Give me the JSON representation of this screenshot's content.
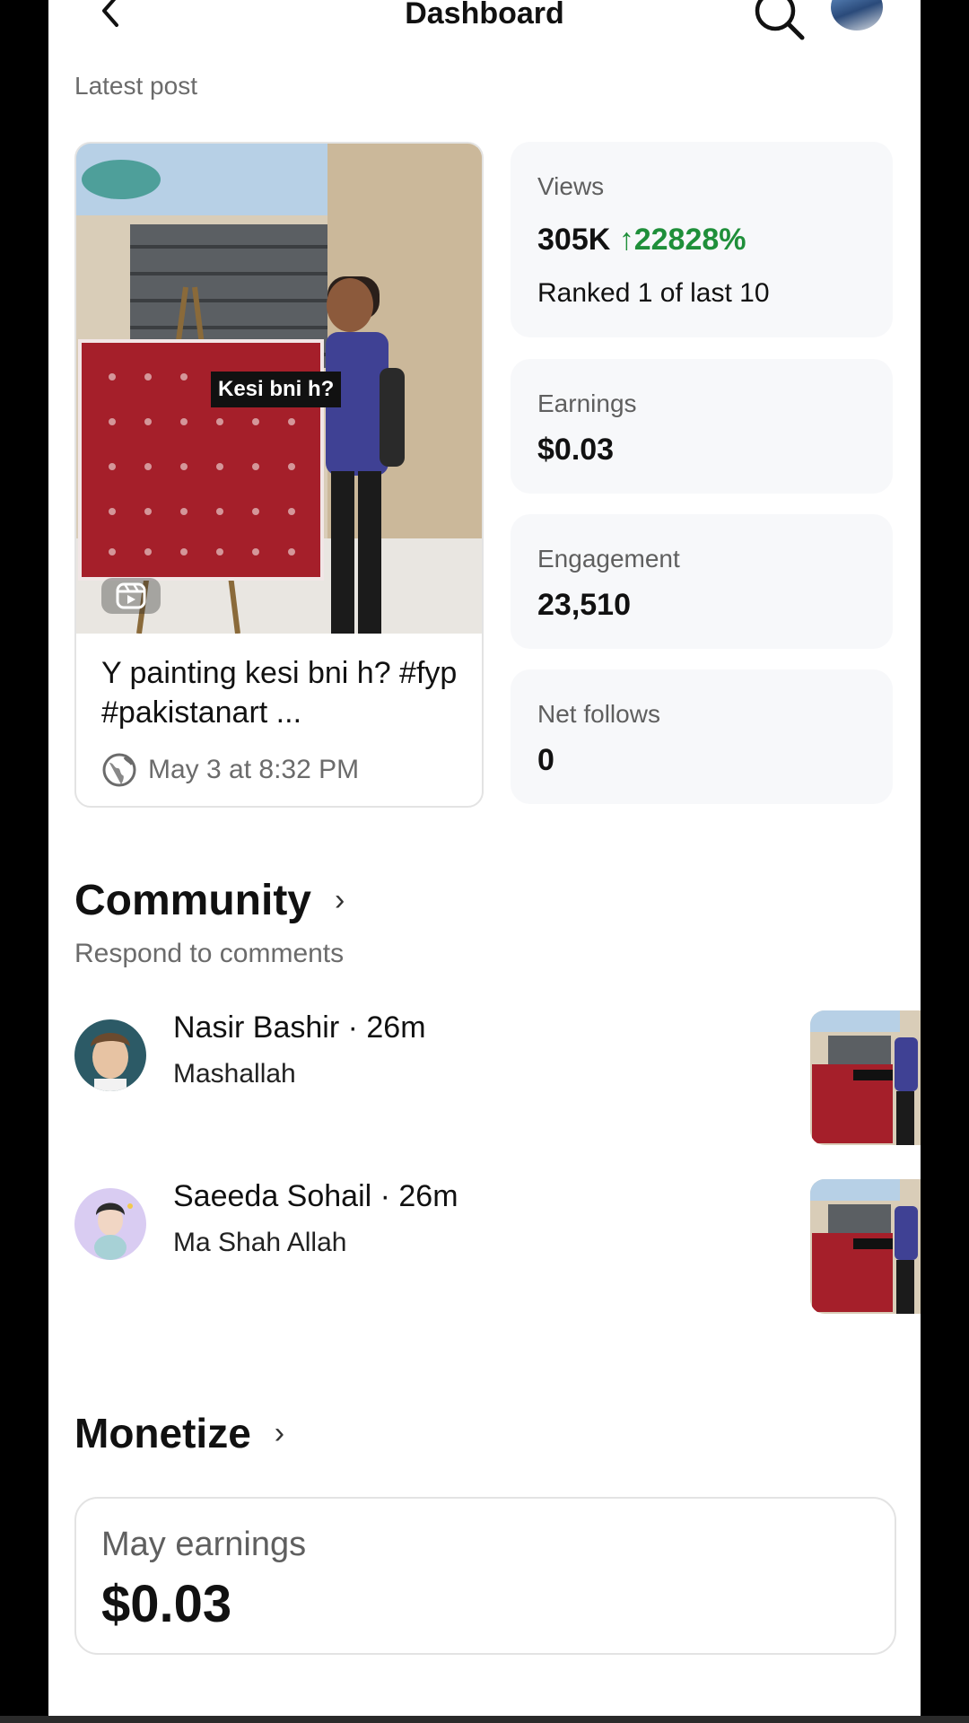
{
  "header": {
    "title": "Dashboard",
    "back_icon": "chevron-left-icon",
    "search_icon": "search-icon",
    "avatar": "profile-avatar"
  },
  "latest_post": {
    "caption_label": "Latest post",
    "overlay_text": "Kesi bni h?",
    "caption": "Y painting kesi bni h? #fyp #pakistanart ...",
    "meta": "May 3 at 8:32 PM",
    "reel_icon": "reel-icon",
    "globe_icon": "globe-icon"
  },
  "stats": [
    {
      "label": "Views",
      "value": "305K",
      "delta": "↑22828%",
      "sub": "Ranked 1 of last 10"
    },
    {
      "label": "Earnings",
      "value": "$0.03"
    },
    {
      "label": "Engagement",
      "value": "23,510"
    },
    {
      "label": "Net follows",
      "value": "0"
    }
  ],
  "community": {
    "title": "Community",
    "subtitle": "Respond to comments",
    "comments": [
      {
        "name_time": "Nasir Bashir · 26m",
        "text": "Mashallah"
      },
      {
        "name_time": "Saeeda Sohail · 26m",
        "text": "Ma Shah Allah"
      }
    ],
    "thumb_overlay": "Kesi bni h?"
  },
  "monetize": {
    "title": "Monetize",
    "card_label": "May earnings",
    "card_value": "$0.03"
  },
  "colors": {
    "positive": "#1f8f3a",
    "card_bg": "#f7f8fa",
    "muted_text": "#6b6b6b"
  }
}
